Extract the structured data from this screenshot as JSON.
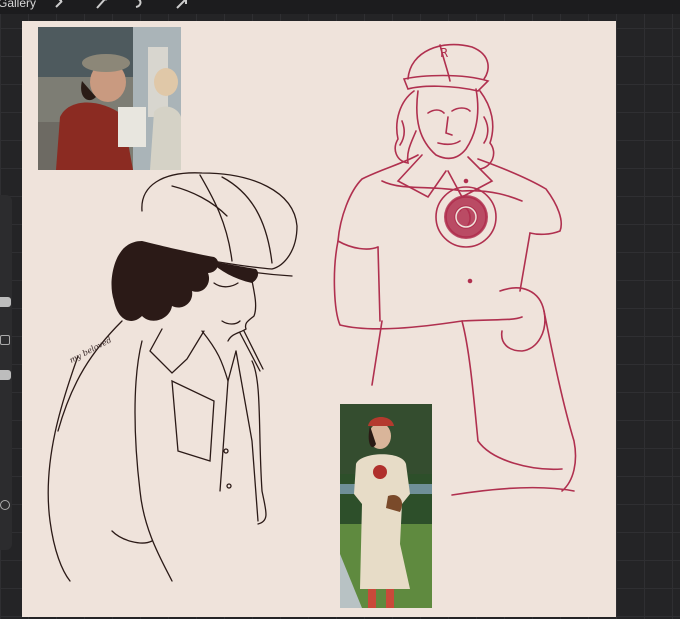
{
  "app": {
    "gallery_label": "Gallery",
    "tools": [
      "wrench-icon",
      "magic-wand-icon",
      "selection-icon",
      "arrow-icon"
    ]
  },
  "canvas": {
    "background": "#efe3db",
    "handwritten_note": "my beloved",
    "accent_sketch_color": "#b0304f",
    "ink_color": "#2b1a17"
  },
  "references": [
    {
      "name": "reference-photo-newsboy"
    },
    {
      "name": "reference-photo-baseball-uniform"
    }
  ]
}
